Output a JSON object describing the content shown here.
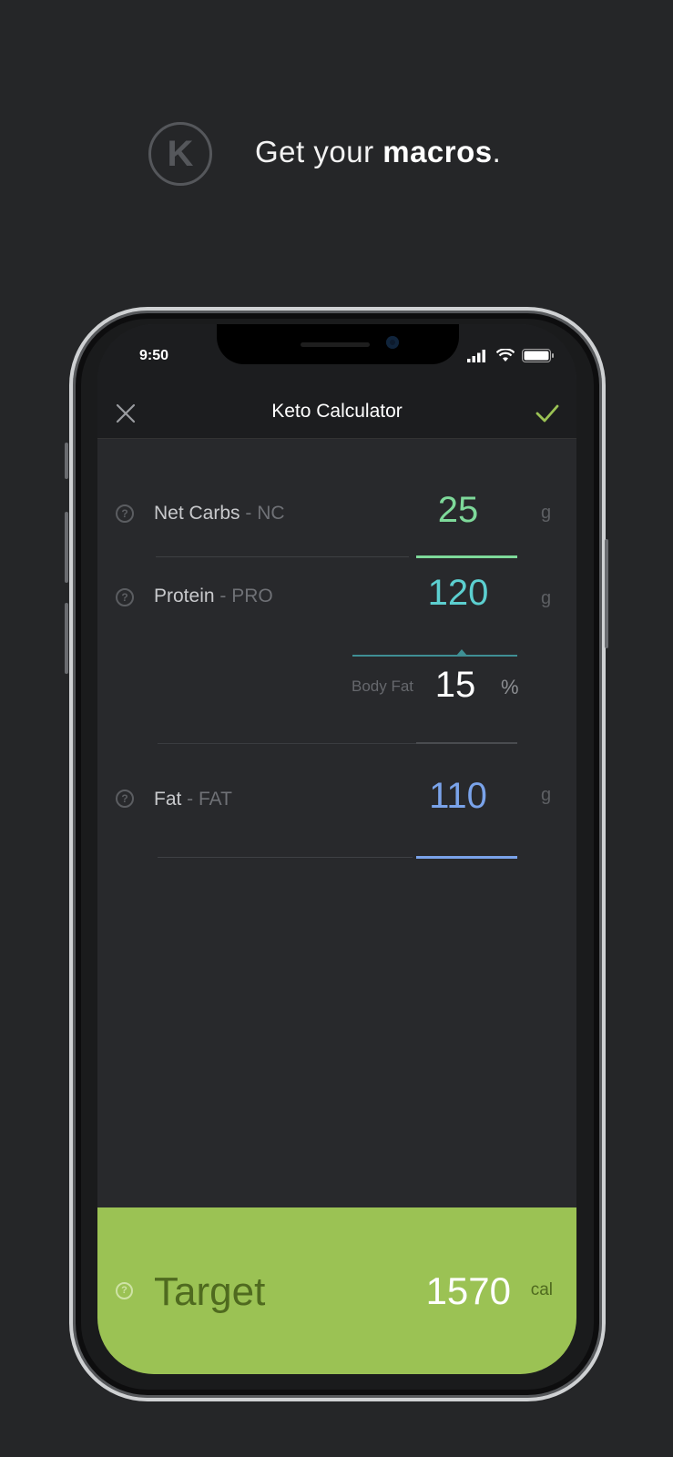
{
  "header": {
    "logo_letter": "K",
    "headline_prefix": "Get your ",
    "headline_bold": "macros",
    "headline_suffix": "."
  },
  "status_bar": {
    "time": "9:50"
  },
  "navbar": {
    "title": "Keto Calculator"
  },
  "rows": {
    "net_carbs": {
      "label": "Net Carbs",
      "abbr": " - NC",
      "value": "25",
      "unit": "g",
      "color": "#7ed99a"
    },
    "protein": {
      "label": "Protein",
      "abbr": " - PRO",
      "value": "120",
      "unit": "g",
      "color": "#5ccfd0"
    },
    "body_fat": {
      "label": "Body Fat",
      "value": "15",
      "unit": "%"
    },
    "fat": {
      "label": "Fat",
      "abbr": " - FAT",
      "value": "110",
      "unit": "g",
      "color": "#7aa3ea"
    }
  },
  "target": {
    "label": "Target",
    "value": "1570",
    "unit": "cal",
    "color": "#9bc254"
  },
  "icons": [
    "close-icon",
    "check-icon",
    "help-icon",
    "signal-icon",
    "wifi-icon",
    "battery-icon"
  ]
}
